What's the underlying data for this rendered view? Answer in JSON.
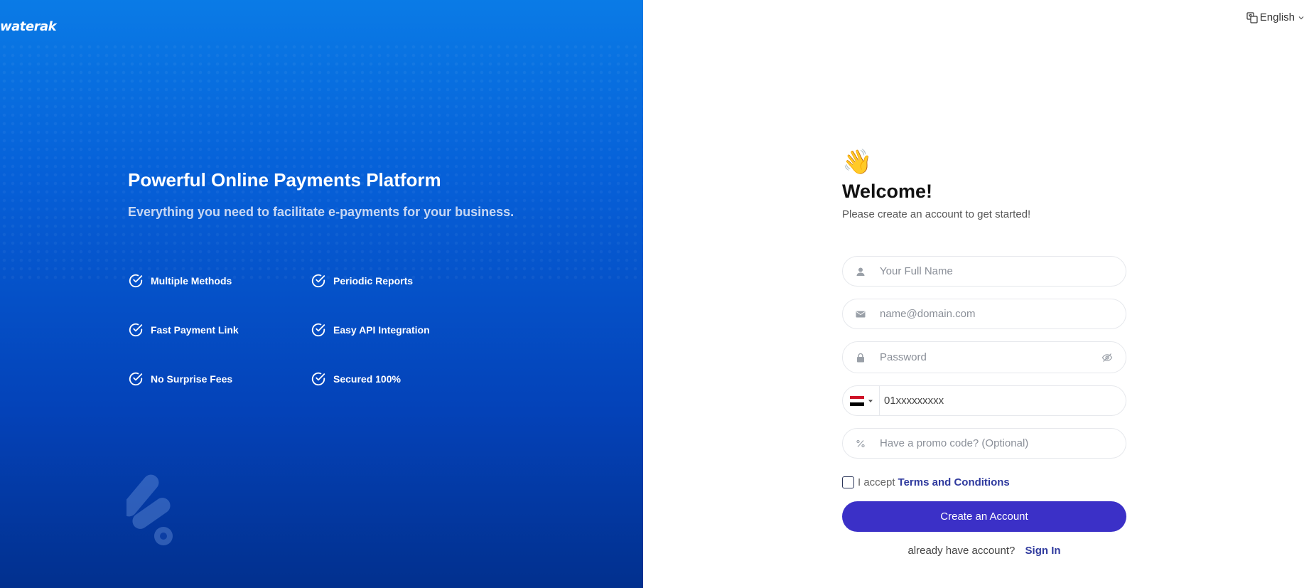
{
  "brand": {
    "logo_text": "waterak"
  },
  "hero": {
    "title": "Powerful Online Payments Platform",
    "subtitle": "Everything you need to facilitate e-payments for your business.",
    "features": [
      "Multiple Methods",
      "Periodic Reports",
      "Fast Payment Link",
      "Easy API Integration",
      "No Surprise Fees",
      "Secured 100%"
    ]
  },
  "language": {
    "selected": "English"
  },
  "form": {
    "wave_emoji": "👋",
    "title": "Welcome!",
    "subtitle": "Please create an account to get started!",
    "full_name_placeholder": "Your Full Name",
    "email_placeholder": "name@domain.com",
    "password_placeholder": "Password",
    "phone_placeholder": "01xxxxxxxxx",
    "promo_placeholder": "Have a promo code? (Optional)",
    "terms_prefix": "I accept",
    "terms_link": "Terms and Conditions",
    "submit_label": "Create an Account",
    "signin_prompt": "already have account?",
    "signin_link": "Sign In"
  },
  "colors": {
    "primary_button": "#3b30c7",
    "link": "#2f3a9e",
    "left_gradient_top": "#0a7be6",
    "left_gradient_bottom": "#02308e"
  }
}
